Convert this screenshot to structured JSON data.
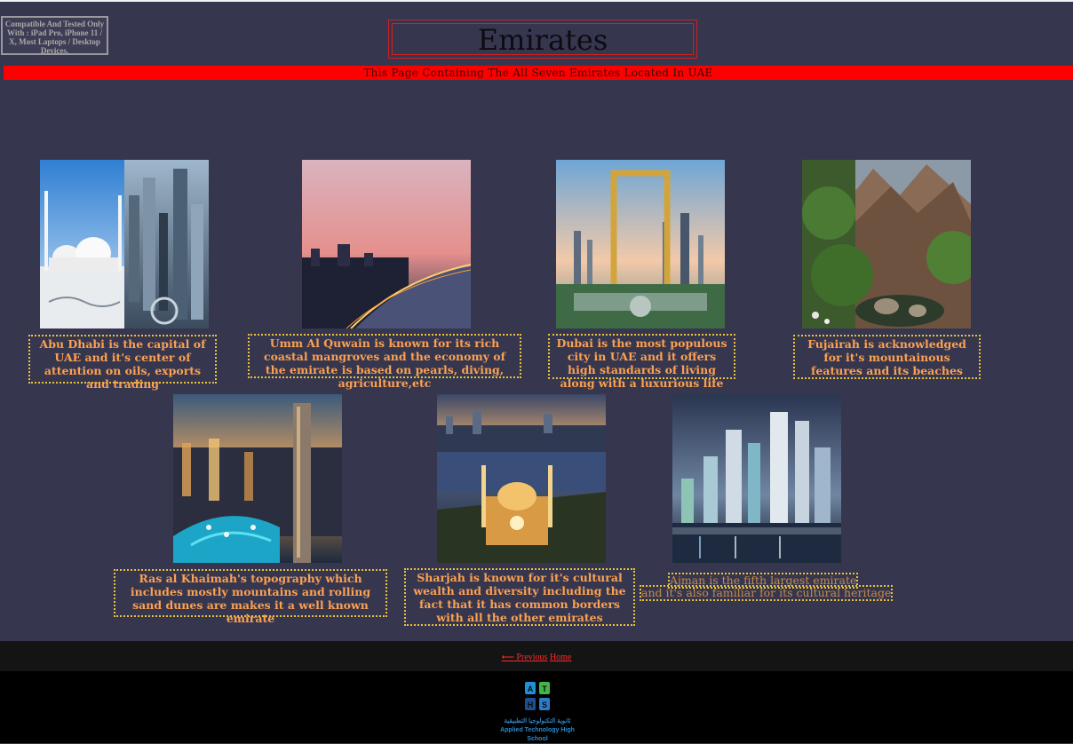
{
  "header": {
    "compatibility_note": "Compatible And Tested Only With : iPad Pro, iPhone 11 / X, Most Laptops / Desktop Devices.",
    "title": "Emirates",
    "subtitle": "This Page Containing The All Seven Emirates Located In UAE"
  },
  "emirates": [
    {
      "name": "abu-dhabi",
      "caption": "Abu Dhabi is the capital of UAE and it's center of attention on oils, exports and trading"
    },
    {
      "name": "umm-al-quwain",
      "caption": "Umm Al Quwain is known for its rich coastal mangroves and the economy of the emirate is based on pearls, diving, agriculture,etc"
    },
    {
      "name": "dubai",
      "caption": "Dubai is the most populous city in UAE and it offers high standards of living along with a luxurious life"
    },
    {
      "name": "fujairah",
      "caption": "Fujairah is acknowledged for it's mountainous features and its beaches"
    },
    {
      "name": "ras-al-khaimah",
      "caption": "Ras al Khaimah's topography which includes mostly mountains and rolling sand dunes are makes it a well known emirate"
    },
    {
      "name": "sharjah",
      "caption": "Sharjah is known for it's cultural wealth and diversity including the fact that it has common borders with all the other emirates"
    },
    {
      "name": "ajman",
      "caption_line1": "Ajman is the fifth largest emirate",
      "caption_line2": "and it's also familiar for its cultural heritage"
    }
  ],
  "footer": {
    "previous_label": "⟵ Previous",
    "home_label": "Home",
    "logo_letters": [
      "A",
      "T",
      "H",
      "S"
    ],
    "logo_arabic": "ثانوية التكنولوجيا التطبيقية",
    "logo_english": "Applied Technology High School"
  },
  "colors": {
    "background": "#36364f",
    "banner_red": "#fe0000",
    "caption_text": "#fca150",
    "caption_border": "#e8c23c",
    "link_red": "#ff2a2a"
  }
}
